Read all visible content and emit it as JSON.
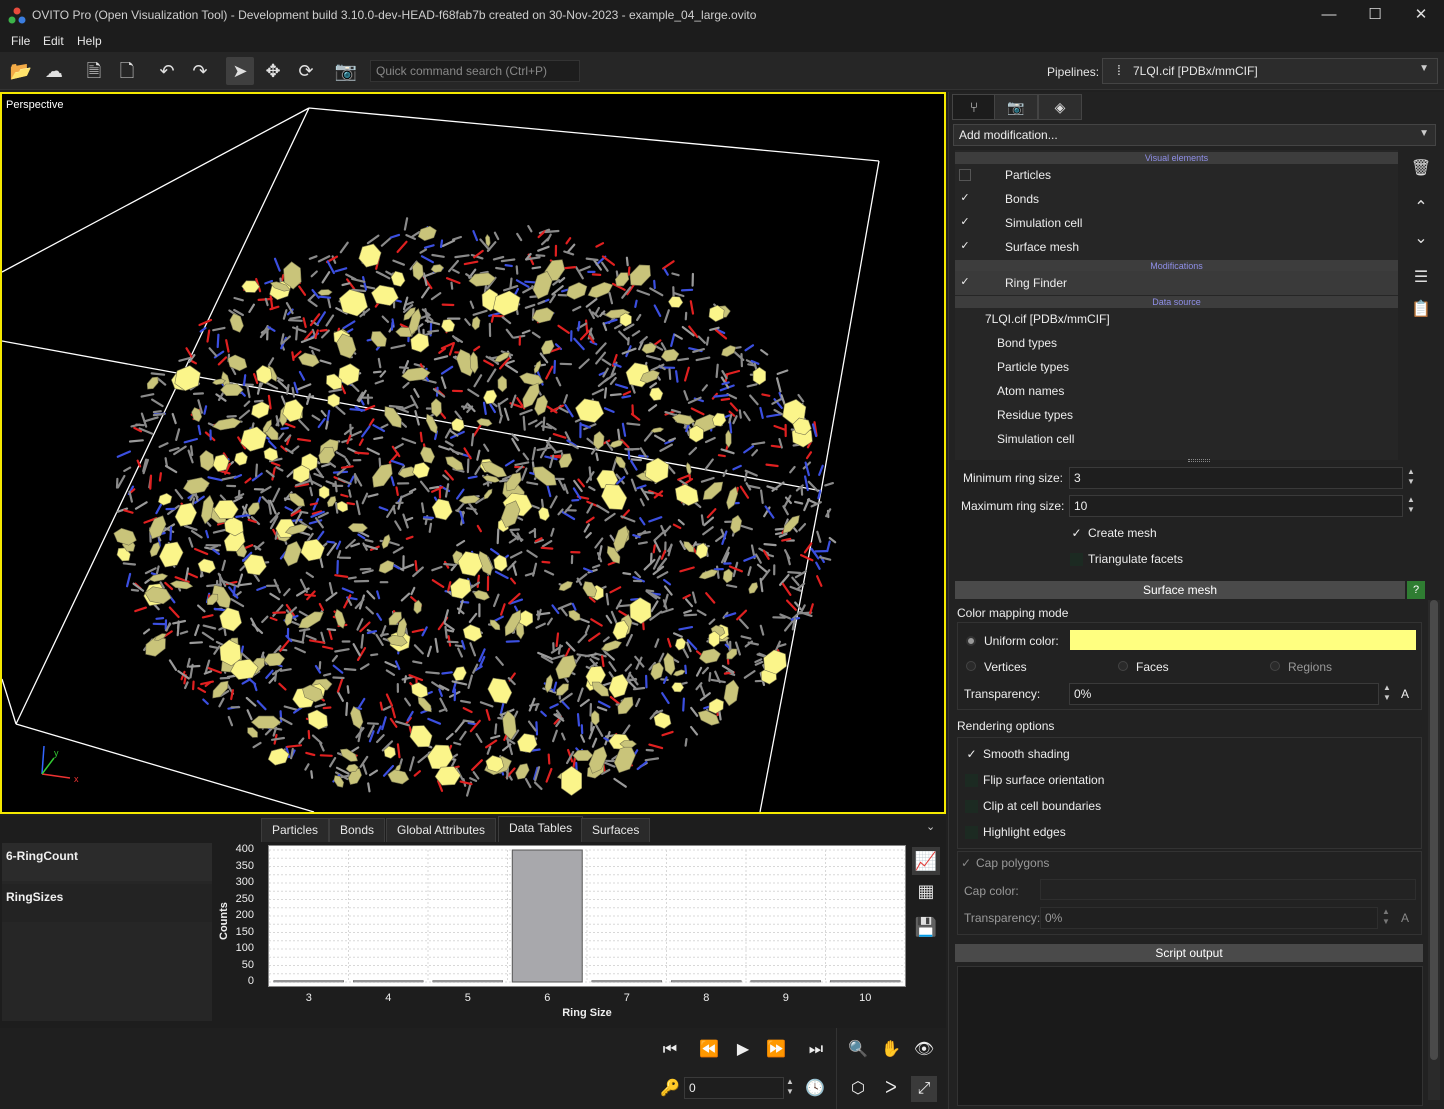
{
  "window": {
    "title": "OVITO Pro (Open Visualization Tool) - Development build 3.10.0-dev-HEAD-f68fab7b created on 30-Nov-2023 - example_04_large.ovito",
    "min": "—",
    "max": "☐",
    "close": "✕"
  },
  "menu": {
    "file": "File",
    "edit": "Edit",
    "help": "Help"
  },
  "toolbar": {
    "quick_search_placeholder": "Quick command search (Ctrl+P)",
    "pipelines_label": "Pipelines:",
    "pipeline_selected": "7LQI.cif [PDBx/mmCIF]"
  },
  "viewport": {
    "label": "Perspective",
    "axis_y": "y",
    "axis_x": "x"
  },
  "inspector": {
    "tabs": [
      "Particles",
      "Bonds",
      "Global Attributes",
      "Data Tables",
      "Surfaces"
    ],
    "active_tab": "Data Tables",
    "tables": [
      "6-RingCount",
      "RingSizes"
    ]
  },
  "chart_data": {
    "type": "bar",
    "categories": [
      "3",
      "4",
      "5",
      "6",
      "7",
      "8",
      "9",
      "10"
    ],
    "values": [
      0,
      0,
      0,
      400,
      0,
      0,
      0,
      0
    ],
    "xlabel": "Ring Size",
    "ylabel": "Counts",
    "ylim": [
      0,
      400
    ],
    "yticks": [
      "0",
      "50",
      "100",
      "150",
      "200",
      "250",
      "300",
      "350",
      "400"
    ],
    "grid": true,
    "bar_color": "#a8a8ac"
  },
  "animation": {
    "frame": "0"
  },
  "panel": {
    "add_modification": "Add modification...",
    "sections": {
      "visual": "Visual elements",
      "modifications": "Modifications",
      "source": "Data source"
    },
    "visual_elements": [
      {
        "label": "Particles",
        "checked": false
      },
      {
        "label": "Bonds",
        "checked": true
      },
      {
        "label": "Simulation cell",
        "checked": true
      },
      {
        "label": "Surface mesh",
        "checked": true
      }
    ],
    "modifications": [
      {
        "label": "Ring Finder",
        "checked": true
      }
    ],
    "source": "7LQI.cif [PDBx/mmCIF]",
    "source_items": [
      "Bond types",
      "Particle types",
      "Atom names",
      "Residue types",
      "Simulation cell"
    ],
    "ring_finder": {
      "min_label": "Minimum ring size:",
      "min_value": "3",
      "max_label": "Maximum ring size:",
      "max_value": "10",
      "create_mesh": "Create mesh",
      "triangulate": "Triangulate facets"
    },
    "surface_mesh": {
      "title": "Surface mesh",
      "help": "?",
      "color_mapping": "Color mapping mode",
      "uniform_color": "Uniform color:",
      "uniform_color_value": "#ffff80",
      "vertices": "Vertices",
      "faces": "Faces",
      "regions": "Regions",
      "transparency_label": "Transparency:",
      "transparency_value": "0%",
      "anim_key": "A",
      "rendering_options": "Rendering options",
      "smooth_shading": "Smooth shading",
      "flip_orientation": "Flip surface orientation",
      "clip_boundaries": "Clip at cell boundaries",
      "highlight_edges": "Highlight edges",
      "cap_polygons": "Cap polygons",
      "cap_color": "Cap color:",
      "cap_transparency_label": "Transparency:",
      "cap_transparency_value": "0%"
    },
    "script_output": "Script output"
  }
}
